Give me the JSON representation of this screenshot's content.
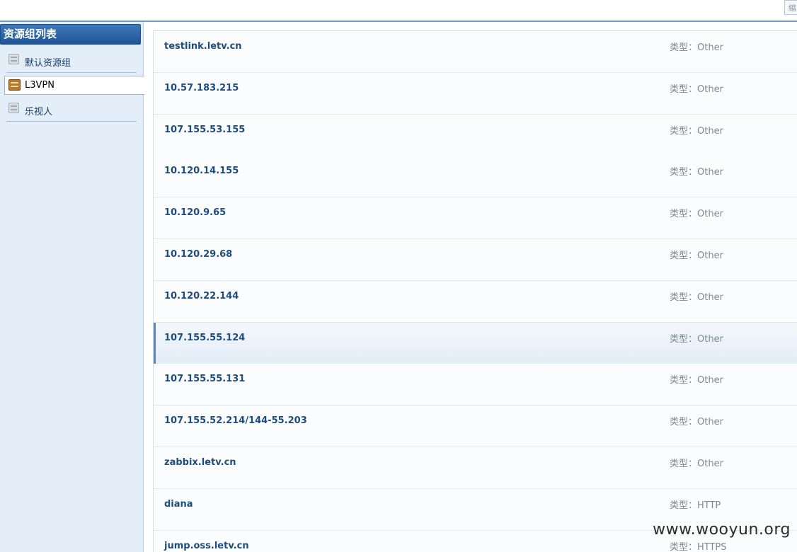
{
  "topbar": {
    "button_label": "縮"
  },
  "sidebar": {
    "title": "资源组列表",
    "groups": [
      {
        "label": "默认资源组",
        "active": false
      },
      {
        "label": "L3VPN",
        "active": true
      },
      {
        "label": "乐视人",
        "active": false
      }
    ]
  },
  "resources": {
    "type_prefix": "类型：",
    "items": [
      {
        "name": "testlink.letv.cn",
        "type": "类型：Other"
      },
      {
        "name": "10.57.183.215",
        "type": "类型：Other"
      },
      {
        "name": "107.155.53.155",
        "type": "类型：Other"
      },
      {
        "name": "10.120.14.155",
        "type": "类型：Other"
      },
      {
        "name": "10.120.9.65",
        "type": "类型：Other"
      },
      {
        "name": "10.120.29.68",
        "type": "类型：Other"
      },
      {
        "name": "10.120.22.144",
        "type": "类型：Other"
      },
      {
        "name": "107.155.55.124",
        "type": "类型：Other",
        "highlighted": true
      },
      {
        "name": "107.155.55.131",
        "type": "类型：Other"
      },
      {
        "name": "107.155.52.214/144-55.203",
        "type": "类型：Other"
      },
      {
        "name": "zabbix.letv.cn",
        "type": "类型：Other"
      },
      {
        "name": "diana",
        "type": "类型：HTTP"
      },
      {
        "name": "jump.oss.letv.cn",
        "type": "类型：HTTPS"
      }
    ]
  },
  "watermark": "www.wooyun.org",
  "colors": {
    "header_blue": "#1f5597",
    "link_blue": "#1e4d7e",
    "sidebar_bg": "#e4eef8"
  }
}
